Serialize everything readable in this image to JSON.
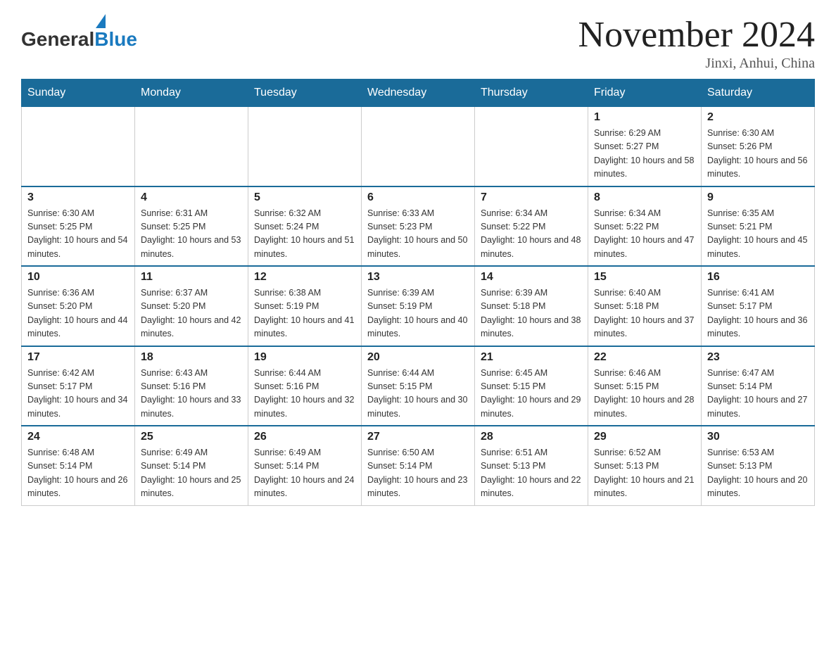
{
  "header": {
    "logo_general": "General",
    "logo_blue": "Blue",
    "month_title": "November 2024",
    "location": "Jinxi, Anhui, China"
  },
  "weekdays": [
    "Sunday",
    "Monday",
    "Tuesday",
    "Wednesday",
    "Thursday",
    "Friday",
    "Saturday"
  ],
  "weeks": [
    [
      {
        "day": "",
        "info": ""
      },
      {
        "day": "",
        "info": ""
      },
      {
        "day": "",
        "info": ""
      },
      {
        "day": "",
        "info": ""
      },
      {
        "day": "",
        "info": ""
      },
      {
        "day": "1",
        "info": "Sunrise: 6:29 AM\nSunset: 5:27 PM\nDaylight: 10 hours and 58 minutes."
      },
      {
        "day": "2",
        "info": "Sunrise: 6:30 AM\nSunset: 5:26 PM\nDaylight: 10 hours and 56 minutes."
      }
    ],
    [
      {
        "day": "3",
        "info": "Sunrise: 6:30 AM\nSunset: 5:25 PM\nDaylight: 10 hours and 54 minutes."
      },
      {
        "day": "4",
        "info": "Sunrise: 6:31 AM\nSunset: 5:25 PM\nDaylight: 10 hours and 53 minutes."
      },
      {
        "day": "5",
        "info": "Sunrise: 6:32 AM\nSunset: 5:24 PM\nDaylight: 10 hours and 51 minutes."
      },
      {
        "day": "6",
        "info": "Sunrise: 6:33 AM\nSunset: 5:23 PM\nDaylight: 10 hours and 50 minutes."
      },
      {
        "day": "7",
        "info": "Sunrise: 6:34 AM\nSunset: 5:22 PM\nDaylight: 10 hours and 48 minutes."
      },
      {
        "day": "8",
        "info": "Sunrise: 6:34 AM\nSunset: 5:22 PM\nDaylight: 10 hours and 47 minutes."
      },
      {
        "day": "9",
        "info": "Sunrise: 6:35 AM\nSunset: 5:21 PM\nDaylight: 10 hours and 45 minutes."
      }
    ],
    [
      {
        "day": "10",
        "info": "Sunrise: 6:36 AM\nSunset: 5:20 PM\nDaylight: 10 hours and 44 minutes."
      },
      {
        "day": "11",
        "info": "Sunrise: 6:37 AM\nSunset: 5:20 PM\nDaylight: 10 hours and 42 minutes."
      },
      {
        "day": "12",
        "info": "Sunrise: 6:38 AM\nSunset: 5:19 PM\nDaylight: 10 hours and 41 minutes."
      },
      {
        "day": "13",
        "info": "Sunrise: 6:39 AM\nSunset: 5:19 PM\nDaylight: 10 hours and 40 minutes."
      },
      {
        "day": "14",
        "info": "Sunrise: 6:39 AM\nSunset: 5:18 PM\nDaylight: 10 hours and 38 minutes."
      },
      {
        "day": "15",
        "info": "Sunrise: 6:40 AM\nSunset: 5:18 PM\nDaylight: 10 hours and 37 minutes."
      },
      {
        "day": "16",
        "info": "Sunrise: 6:41 AM\nSunset: 5:17 PM\nDaylight: 10 hours and 36 minutes."
      }
    ],
    [
      {
        "day": "17",
        "info": "Sunrise: 6:42 AM\nSunset: 5:17 PM\nDaylight: 10 hours and 34 minutes."
      },
      {
        "day": "18",
        "info": "Sunrise: 6:43 AM\nSunset: 5:16 PM\nDaylight: 10 hours and 33 minutes."
      },
      {
        "day": "19",
        "info": "Sunrise: 6:44 AM\nSunset: 5:16 PM\nDaylight: 10 hours and 32 minutes."
      },
      {
        "day": "20",
        "info": "Sunrise: 6:44 AM\nSunset: 5:15 PM\nDaylight: 10 hours and 30 minutes."
      },
      {
        "day": "21",
        "info": "Sunrise: 6:45 AM\nSunset: 5:15 PM\nDaylight: 10 hours and 29 minutes."
      },
      {
        "day": "22",
        "info": "Sunrise: 6:46 AM\nSunset: 5:15 PM\nDaylight: 10 hours and 28 minutes."
      },
      {
        "day": "23",
        "info": "Sunrise: 6:47 AM\nSunset: 5:14 PM\nDaylight: 10 hours and 27 minutes."
      }
    ],
    [
      {
        "day": "24",
        "info": "Sunrise: 6:48 AM\nSunset: 5:14 PM\nDaylight: 10 hours and 26 minutes."
      },
      {
        "day": "25",
        "info": "Sunrise: 6:49 AM\nSunset: 5:14 PM\nDaylight: 10 hours and 25 minutes."
      },
      {
        "day": "26",
        "info": "Sunrise: 6:49 AM\nSunset: 5:14 PM\nDaylight: 10 hours and 24 minutes."
      },
      {
        "day": "27",
        "info": "Sunrise: 6:50 AM\nSunset: 5:14 PM\nDaylight: 10 hours and 23 minutes."
      },
      {
        "day": "28",
        "info": "Sunrise: 6:51 AM\nSunset: 5:13 PM\nDaylight: 10 hours and 22 minutes."
      },
      {
        "day": "29",
        "info": "Sunrise: 6:52 AM\nSunset: 5:13 PM\nDaylight: 10 hours and 21 minutes."
      },
      {
        "day": "30",
        "info": "Sunrise: 6:53 AM\nSunset: 5:13 PM\nDaylight: 10 hours and 20 minutes."
      }
    ]
  ]
}
